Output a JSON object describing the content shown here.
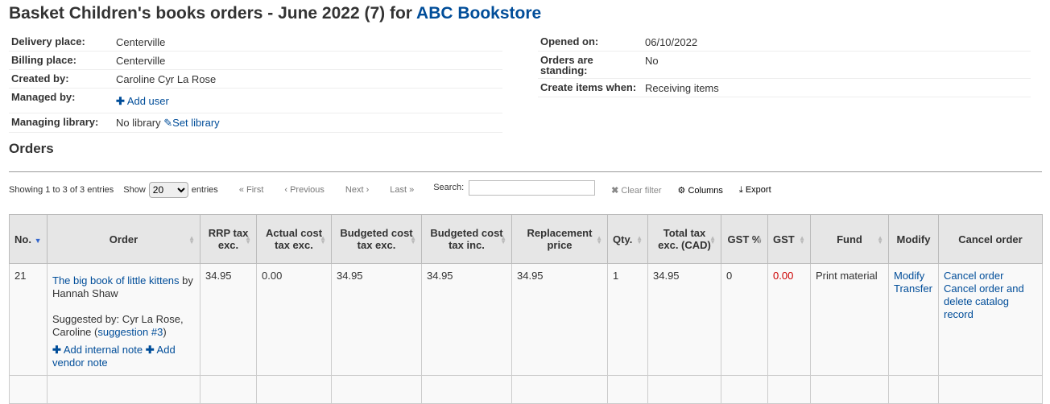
{
  "title": {
    "prefix": "Basket Children's books orders - June 2022 (7) for ",
    "vendor": "ABC Bookstore"
  },
  "left_info": [
    {
      "label": "Delivery place:",
      "value": "Centerville"
    },
    {
      "label": "Billing place:",
      "value": "Centerville"
    },
    {
      "label": "Created by:",
      "value": "Caroline Cyr La Rose"
    },
    {
      "label": "Managed by:",
      "link": "Add user"
    },
    {
      "label": "Managing library:",
      "value": "No library",
      "link": "Set library"
    }
  ],
  "right_info": [
    {
      "label": "Opened on:",
      "value": "06/10/2022"
    },
    {
      "label": "Orders are standing:",
      "value": "No"
    },
    {
      "label": "Create items when:",
      "value": "Receiving items"
    }
  ],
  "orders_heading": "Orders",
  "toolbar": {
    "info": "Showing 1 to 3 of 3 entries",
    "show": "Show",
    "length": "20",
    "entries": "entries",
    "first": "« First",
    "previous": "‹ Previous",
    "next": "Next ›",
    "last": "Last »",
    "search": "Search:",
    "clear": "Clear filter",
    "columns": "Columns",
    "export": "Export"
  },
  "columns": [
    "No.",
    "Order",
    "RRP tax exc.",
    "Actual cost tax exc.",
    "Budgeted cost tax exc.",
    "Budgeted cost tax inc.",
    "Replacement price",
    "Qty.",
    "Total tax exc. (CAD)",
    "GST %",
    "GST",
    "Fund",
    "Modify",
    "Cancel order"
  ],
  "row": {
    "no": "21",
    "title": "The big book of little kittens",
    "by": " by Hannah Shaw",
    "suggested": "Suggested by: Cyr La Rose, Caroline (",
    "suggestion": "suggestion #3",
    "close": ")",
    "add_internal": "Add internal note",
    "add_vendor": "Add vendor note",
    "rrp": "34.95",
    "actual": "0.00",
    "bexc": "34.95",
    "binc": "34.95",
    "replacement": "34.95",
    "qty": "1",
    "total": "34.95",
    "gst_pct": "0",
    "gst": "0.00",
    "fund": "Print material",
    "modify": "Modify",
    "transfer": "Transfer",
    "cancel": "Cancel order",
    "cancel_delete": "Cancel order and delete catalog record"
  }
}
